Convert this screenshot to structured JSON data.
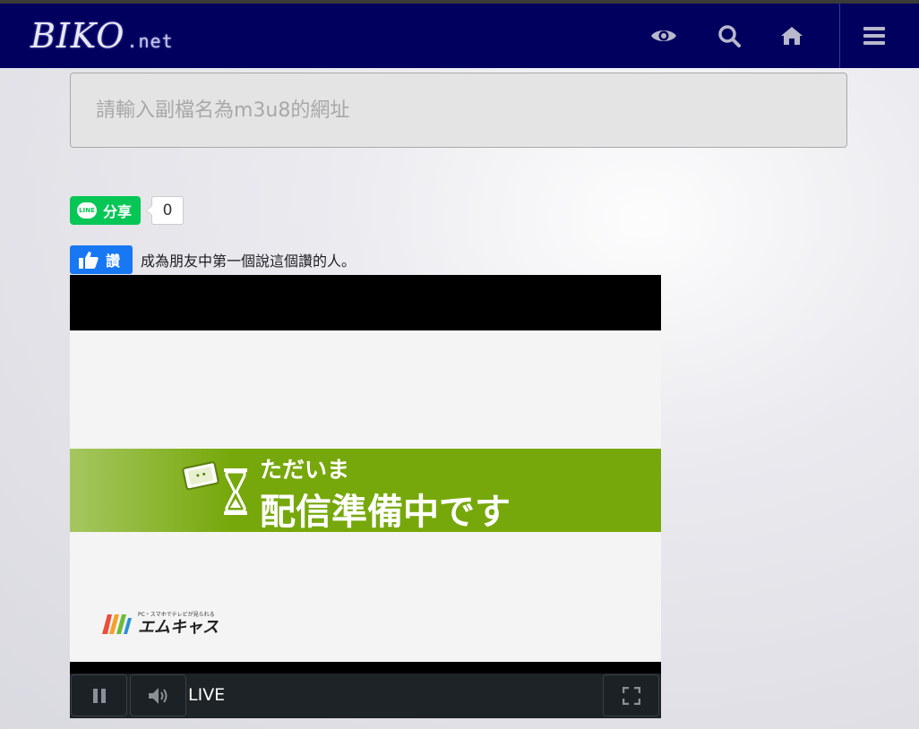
{
  "site": {
    "logo_text": "BIKO",
    "logo_suffix": ".net"
  },
  "nav": {
    "icons": [
      "eye-icon",
      "search-icon",
      "home-icon",
      "menu-icon"
    ],
    "bg_color": "#02005f"
  },
  "search": {
    "placeholder": "請輸入副檔名為m3u8的網址",
    "value": ""
  },
  "line_share": {
    "label": "分享",
    "logo_text": "LINE",
    "count": "0",
    "color": "#06c755"
  },
  "facebook": {
    "like_label": "讚",
    "social_text": "成為朋友中第一個說這個讚的人。",
    "color": "#1877f2"
  },
  "video": {
    "banner_line1": "ただいま",
    "banner_line2": "配信準備中です",
    "banner_color": "#76a80b",
    "brand_tagline": "PC・スマホでテレビが見られる",
    "brand_name": "エムキャス"
  },
  "player_controls": {
    "live_label": "LIVE",
    "buttons": [
      "pause-icon",
      "volume-icon",
      "fullscreen-icon"
    ]
  }
}
